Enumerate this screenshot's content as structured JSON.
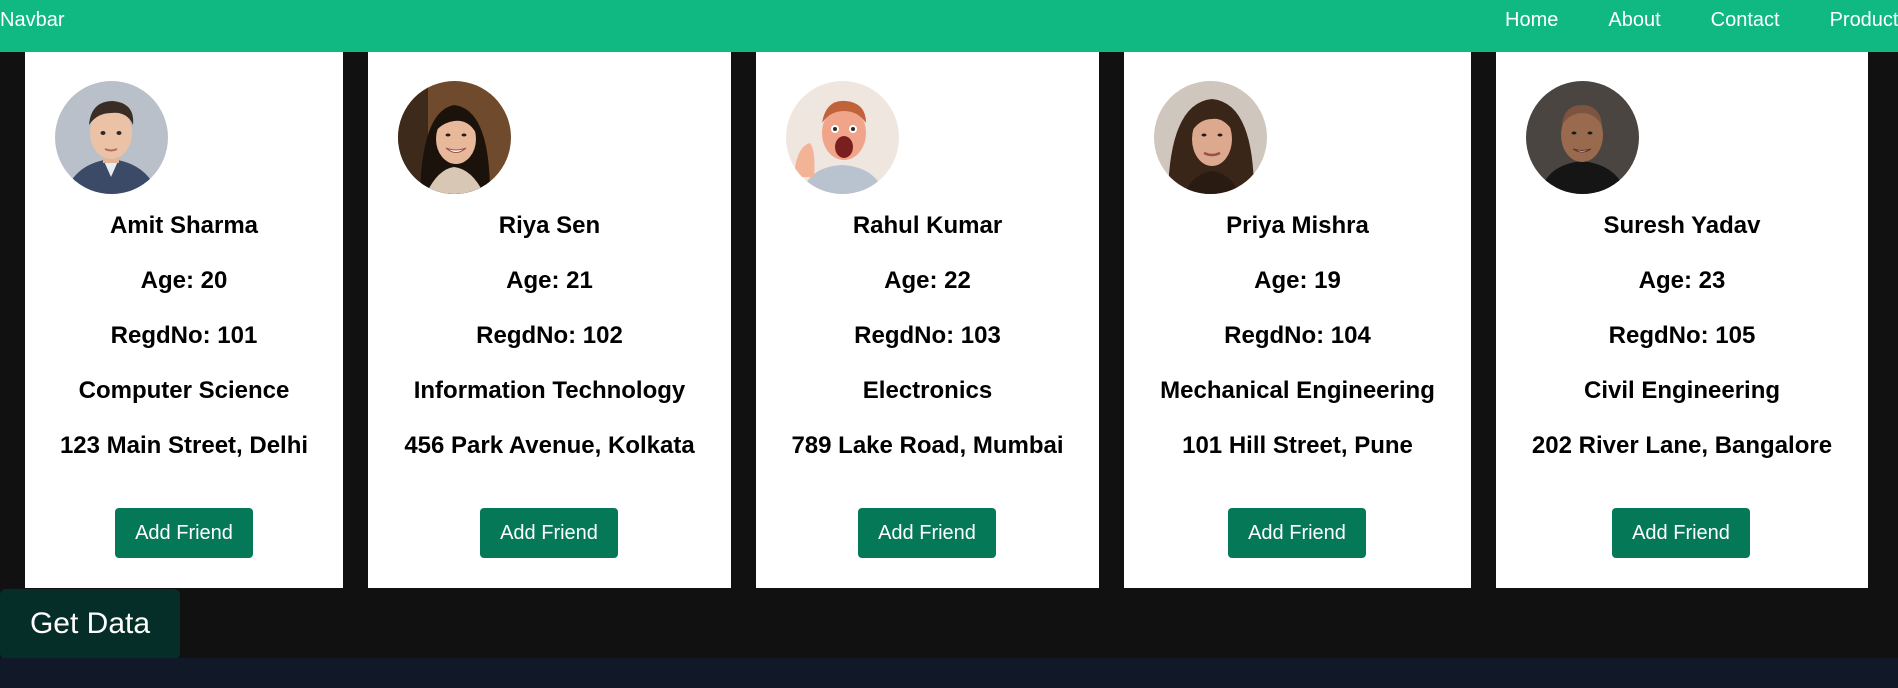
{
  "navbar": {
    "brand": "Navbar",
    "links": [
      "Home",
      "About",
      "Contact",
      "Product"
    ]
  },
  "students": [
    {
      "name": "Amit Sharma",
      "age": "Age: 20",
      "regd": "RegdNo: 101",
      "branch": "Computer Science",
      "address": "123 Main Street, Delhi",
      "button": "Add Friend"
    },
    {
      "name": "Riya Sen",
      "age": "Age: 21",
      "regd": "RegdNo: 102",
      "branch": "Information Technology",
      "address": "456 Park Avenue, Kolkata",
      "button": "Add Friend"
    },
    {
      "name": "Rahul Kumar",
      "age": "Age: 22",
      "regd": "RegdNo: 103",
      "branch": "Electronics",
      "address": "789 Lake Road, Mumbai",
      "button": "Add Friend"
    },
    {
      "name": "Priya Mishra",
      "age": "Age: 19",
      "regd": "RegdNo: 104",
      "branch": "Mechanical Engineering",
      "address": "101 Hill Street, Pune",
      "button": "Add Friend"
    },
    {
      "name": "Suresh Yadav",
      "age": "Age: 23",
      "regd": "RegdNo: 105",
      "branch": "Civil Engineering",
      "address": "202 River Lane, Bangalore",
      "button": "Add Friend"
    }
  ],
  "actions": {
    "get_data_label": "Get Data"
  },
  "colors": {
    "navbar_bg": "#10b981",
    "button_bg": "#047857",
    "get_data_bg": "#062e29",
    "page_bg": "#111111"
  }
}
